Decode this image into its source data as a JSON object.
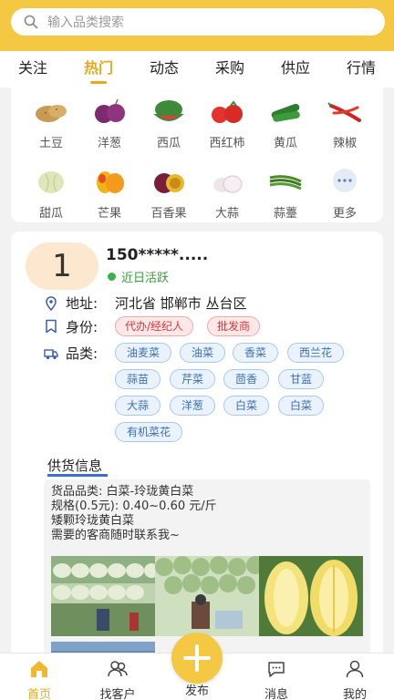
{
  "search": {
    "placeholder": "输入品类搜索"
  },
  "tabs": [
    "关注",
    "热门",
    "动态",
    "采购",
    "供应",
    "行情"
  ],
  "categories": [
    {
      "label": "土豆",
      "icon": "potato-icon"
    },
    {
      "label": "洋葱",
      "icon": "onion-icon"
    },
    {
      "label": "西瓜",
      "icon": "watermelon-icon"
    },
    {
      "label": "西红柿",
      "icon": "tomato-icon"
    },
    {
      "label": "黄瓜",
      "icon": "cucumber-icon"
    },
    {
      "label": "辣椒",
      "icon": "chili-icon"
    },
    {
      "label": "甜瓜",
      "icon": "melon-icon"
    },
    {
      "label": "芒果",
      "icon": "mango-icon"
    },
    {
      "label": "百香果",
      "icon": "passionfruit-icon"
    },
    {
      "label": "大蒜",
      "icon": "garlic-icon"
    },
    {
      "label": "蒜薹",
      "icon": "garlic-scape-icon"
    },
    {
      "label": "更多",
      "icon": "more-icon"
    }
  ],
  "profile": {
    "avatar_text": "1",
    "name": "150*****.....",
    "status": "近日活跃",
    "address_label": "地址:",
    "address_value": "河北省 邯郸市 丛台区",
    "identity_label": "身份:",
    "roles": [
      "代办/经纪人",
      "批发商"
    ],
    "category_label": "品类:",
    "tags": [
      "油麦菜",
      "油菜",
      "香菜",
      "西兰花",
      "蒜苗",
      "芹菜",
      "茴香",
      "甘蓝",
      "大蒜",
      "洋葱",
      "白菜",
      "白菜",
      "有机菜花"
    ]
  },
  "supply": {
    "title": "供货信息",
    "lines": [
      "货品品类:  白菜-玲珑黄白菜",
      "规格(0.5元): 0.40~0.60 元/斤",
      "矮颗玲珑黄白菜",
      "需要的客商随时联系我~"
    ]
  },
  "nav": {
    "home": "首页",
    "find_customers": "找客户",
    "publish": "发布",
    "messages": "消息",
    "mine": "我的"
  },
  "colors": {
    "brand": "#f5c843",
    "accent": "#e4a91e",
    "role_red": "#d9363e",
    "tag_blue": "#3c6fb0"
  }
}
